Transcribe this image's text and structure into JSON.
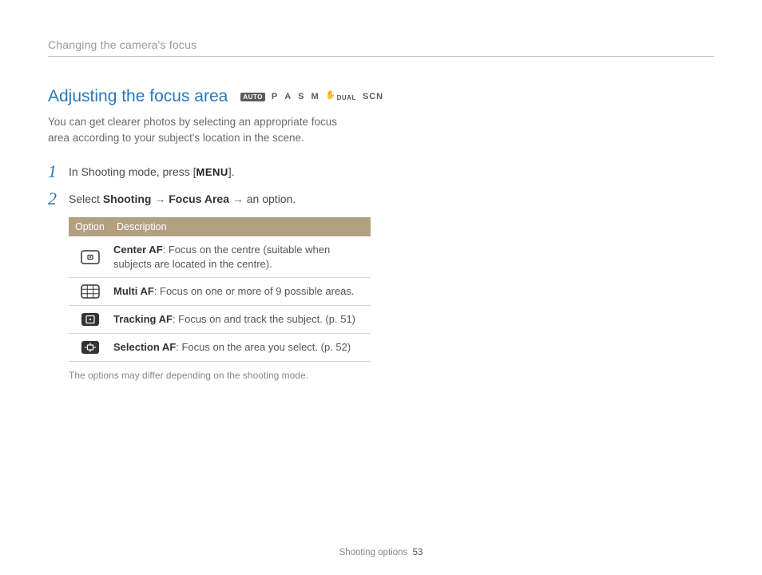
{
  "header": {
    "breadcrumb": "Changing the camera's focus"
  },
  "section": {
    "title": "Adjusting the focus area",
    "modes": {
      "auto": "AUTO",
      "p": "P",
      "a": "A",
      "s": "S",
      "m": "M",
      "dual": "DUAL",
      "scn": "SCN"
    },
    "intro": "You can get clearer photos by selecting an appropriate focus area according to your subject's location in the scene."
  },
  "steps": {
    "s1": {
      "num": "1",
      "pre": "In Shooting mode, press [",
      "menu": "MENU",
      "post": "]."
    },
    "s2": {
      "num": "2",
      "pre": "Select ",
      "b1": "Shooting",
      "arrow1": " → ",
      "b2": "Focus Area",
      "arrow2": " → ",
      "post": "an option."
    }
  },
  "table": {
    "h_option": "Option",
    "h_desc": "Description",
    "rows": [
      {
        "icon": "center-af-icon",
        "name": "Center AF",
        "desc": ": Focus on the centre (suitable when subjects are located in the centre)."
      },
      {
        "icon": "multi-af-icon",
        "name": "Multi AF",
        "desc": ": Focus on one or more of 9 possible areas."
      },
      {
        "icon": "tracking-af-icon",
        "name": "Tracking AF",
        "desc": ": Focus on and track the subject. (p. 51)"
      },
      {
        "icon": "selection-af-icon",
        "name": "Selection AF",
        "desc": ": Focus on the area you select. (p. 52)"
      }
    ]
  },
  "footnote": "The options may differ depending on the shooting mode.",
  "footer": {
    "section": "Shooting options",
    "page": "53"
  }
}
